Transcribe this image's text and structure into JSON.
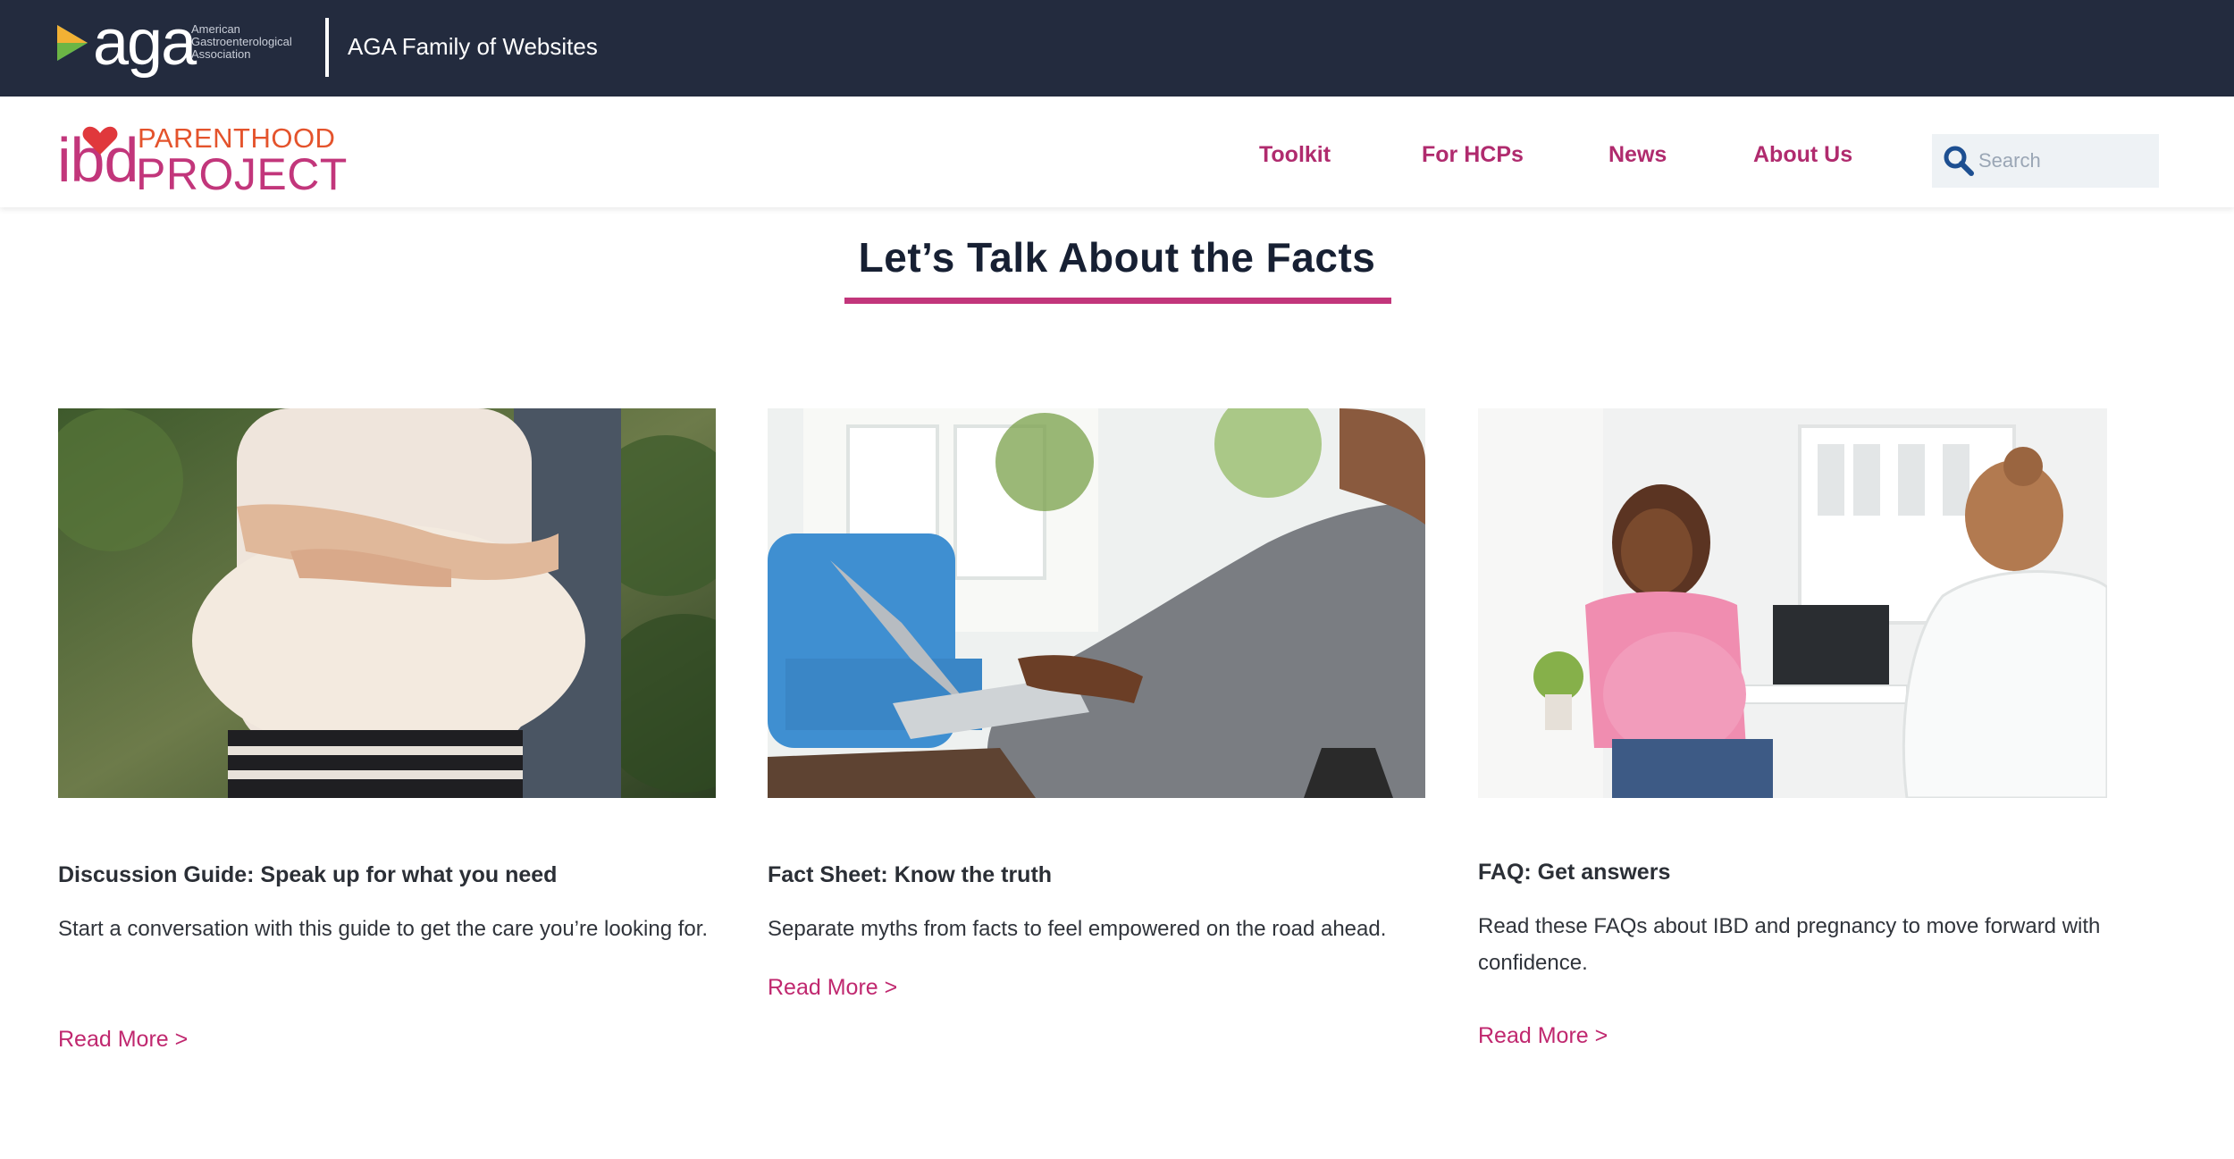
{
  "topbar": {
    "logo_word": "aga",
    "logo_subtitle": "American Gastroenterological Association",
    "family_title": "AGA Family of Websites"
  },
  "navbar": {
    "logo": {
      "ibd": "ibd",
      "parenthood": "PARENTHOOD",
      "project": "PROJECT"
    },
    "items": [
      {
        "label": "Toolkit"
      },
      {
        "label": "For HCPs"
      },
      {
        "label": "News"
      },
      {
        "label": "About Us"
      }
    ],
    "search": {
      "placeholder": "Search",
      "value": ""
    }
  },
  "section": {
    "title": "Let’s Talk About the Facts"
  },
  "cards": [
    {
      "title": "Discussion Guide: Speak up for what you need",
      "description": "Start a conversation with this guide to get the care you’re looking for.",
      "link": "Read More >"
    },
    {
      "title": "Fact Sheet: Know the truth",
      "description": "Separate myths from facts to feel empowered on the road ahead.",
      "link": "Read More >"
    },
    {
      "title": "FAQ: Get answers",
      "description": "Read these FAQs about IBD and pregnancy to move forward with confidence.",
      "link": "Read More >"
    }
  ],
  "colors": {
    "topbar_bg": "#232b3e",
    "brand_magenta": "#c2367b",
    "brand_orange": "#e4532c",
    "nav_text": "#b02b6e",
    "heading": "#172033"
  }
}
